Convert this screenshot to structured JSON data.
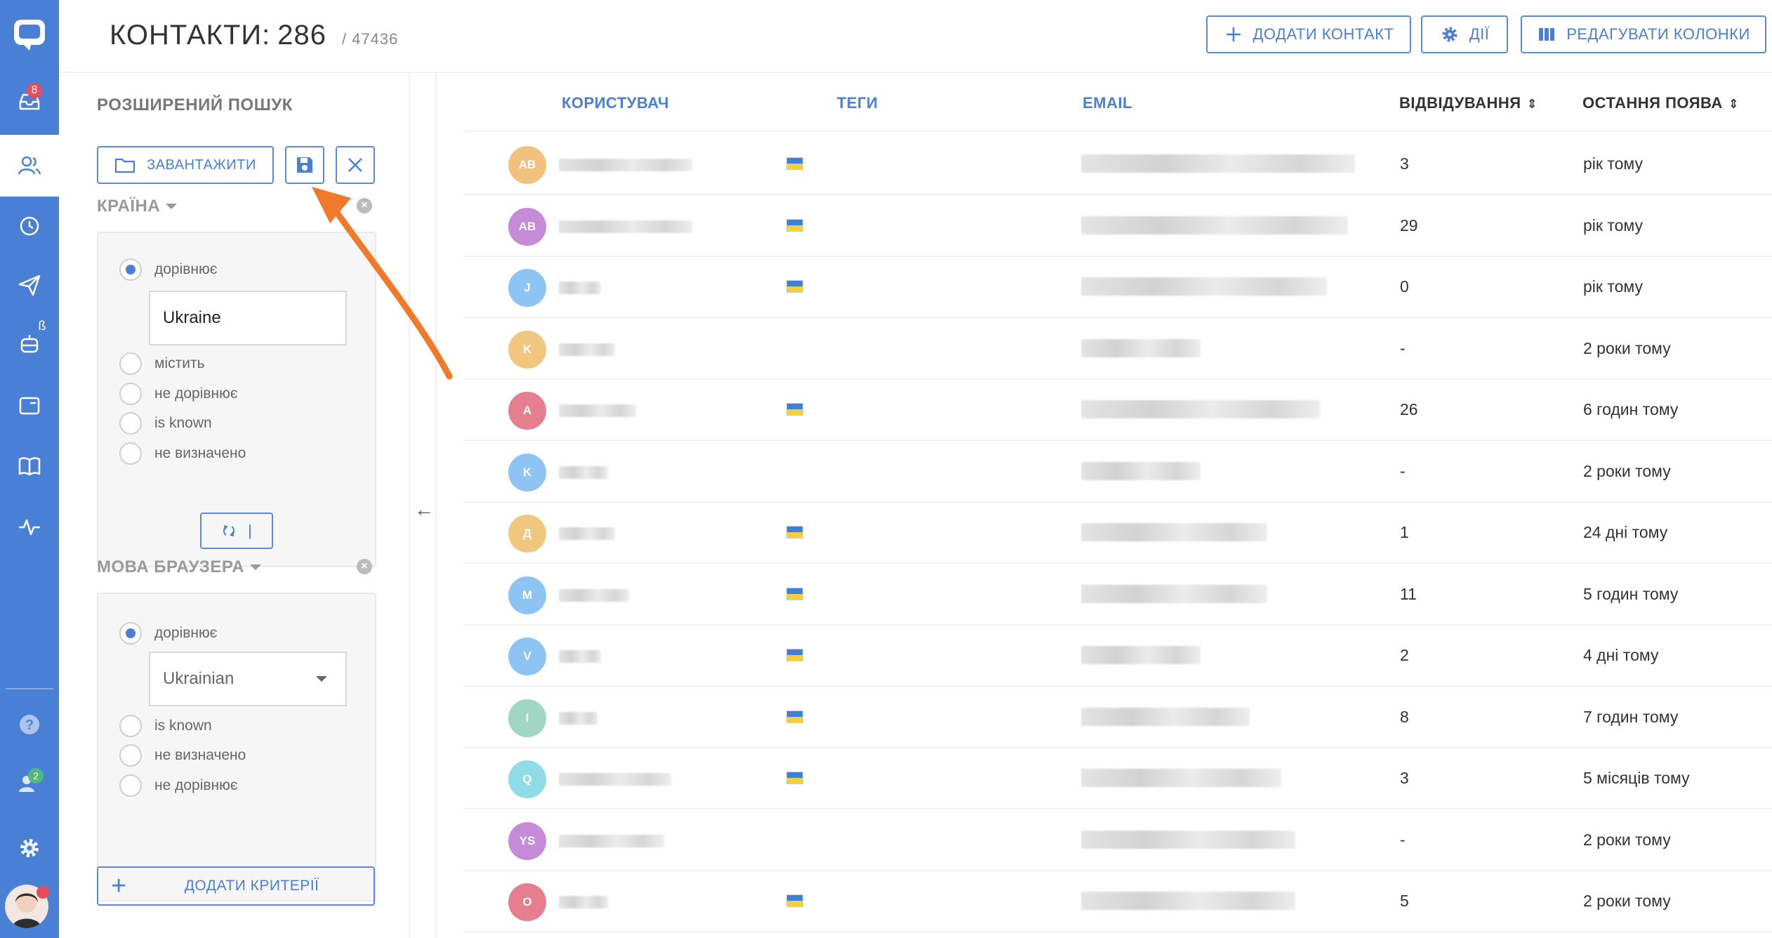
{
  "header": {
    "title": "КОНТАКТИ:",
    "count": "286",
    "total": "/ 47436",
    "add_contact_label": "ДОДАТИ КОНТАКТ",
    "actions_label": "ДІЇ",
    "edit_columns_label": "РЕДАГУВАТИ КОЛОНКИ"
  },
  "nav": {
    "inbox_badge": "8",
    "bot_beta_mark": "ß",
    "team_badge": "2"
  },
  "filter": {
    "title": "РОЗШИРЕНИЙ ПОШУК",
    "load_label": "ЗАВАНТАЖИТИ",
    "or_label": "|",
    "add_criteria_label": "ДОДАТИ КРИТЕРІЇ",
    "criteria": [
      {
        "title": "КРАЇНА",
        "options": [
          "дорівнює",
          "містить",
          "не дорівнює",
          "is known",
          "не визначено"
        ],
        "selected": "дорівнює",
        "value": "Ukraine"
      },
      {
        "title": "МОВА БРАУЗЕРА",
        "options": [
          "дорівнює",
          "is known",
          "не визначено",
          "не дорівнює"
        ],
        "selected": "дорівнює",
        "value": "Ukrainian"
      }
    ]
  },
  "table": {
    "columns": {
      "user": "КОРИСТУВАЧ",
      "tags": "ТЕГИ",
      "email": "EMAIL",
      "visits": "ВІДВІДУВАННЯ",
      "last_seen": "ОСТАННЯ ПОЯВА"
    },
    "rows": [
      {
        "initials": "AB",
        "color": "#f1c27d",
        "flag": true,
        "visits": "3",
        "last_seen": "рік тому"
      },
      {
        "initials": "AB",
        "color": "#c58bd9",
        "flag": true,
        "visits": "29",
        "last_seen": "рік тому"
      },
      {
        "initials": "J",
        "color": "#8ec4f3",
        "flag": true,
        "visits": "0",
        "last_seen": "рік тому"
      },
      {
        "initials": "K",
        "color": "#f1c77f",
        "flag": false,
        "visits": "-",
        "last_seen": "2 роки тому"
      },
      {
        "initials": "A",
        "color": "#e57f8f",
        "flag": true,
        "visits": "26",
        "last_seen": "6 годин тому"
      },
      {
        "initials": "K",
        "color": "#8ec4f3",
        "flag": false,
        "visits": "-",
        "last_seen": "2 роки тому"
      },
      {
        "initials": "Д",
        "color": "#f1c77f",
        "flag": true,
        "visits": "1",
        "last_seen": "24 дні тому"
      },
      {
        "initials": "M",
        "color": "#8ec4f3",
        "flag": true,
        "visits": "11",
        "last_seen": "5 годин тому"
      },
      {
        "initials": "V",
        "color": "#8ec4f3",
        "flag": true,
        "visits": "2",
        "last_seen": "4 дні тому"
      },
      {
        "initials": "I",
        "color": "#9fd6c4",
        "flag": true,
        "visits": "8",
        "last_seen": "7 годин тому"
      },
      {
        "initials": "Q",
        "color": "#8fdbe6",
        "flag": true,
        "visits": "3",
        "last_seen": "5 місяців тому"
      },
      {
        "initials": "YS",
        "color": "#c58bd9",
        "flag": false,
        "visits": "-",
        "last_seen": "2 роки тому"
      },
      {
        "initials": "O",
        "color": "#e57f8f",
        "flag": true,
        "visits": "5",
        "last_seen": "2 роки тому"
      }
    ]
  },
  "colors": {
    "accent": "#4a7fd6",
    "nav_bg": "#4a7fd6",
    "annotation_arrow": "#f07a2a",
    "flag_blue": "#3d7fd9",
    "flag_yellow": "#f4d03f"
  }
}
